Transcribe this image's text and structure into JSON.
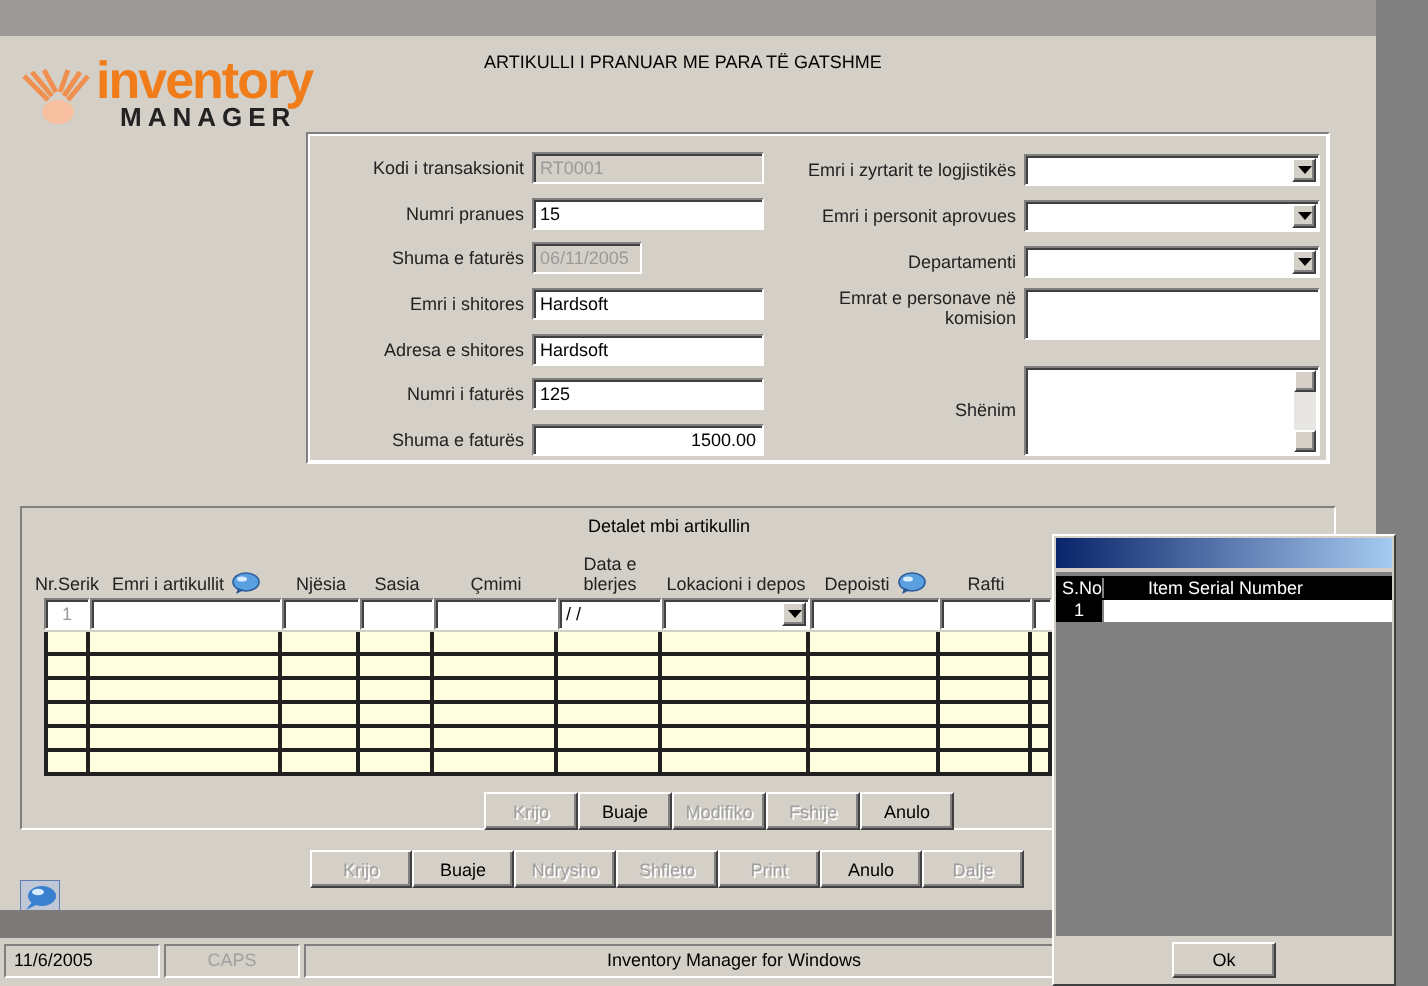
{
  "title": "ARTIKULLI I PRANUAR ME PARA TË GATSHME",
  "logo": {
    "word": "inventory",
    "sub": "MANAGER"
  },
  "left_fields": [
    {
      "label": "Kodi i transaksionit",
      "value": "RT0001",
      "disabled": true,
      "kind": "wide"
    },
    {
      "label": "Numri pranues",
      "value": "15",
      "disabled": false,
      "kind": "wide"
    },
    {
      "label": "Shuma e faturës",
      "value": "06/11/2005",
      "disabled": true,
      "kind": "short"
    },
    {
      "label": "Emri i shitores",
      "value": "Hardsoft",
      "disabled": false,
      "kind": "wide"
    },
    {
      "label": "Adresa e shitores",
      "value": "Hardsoft",
      "disabled": false,
      "kind": "wide"
    },
    {
      "label": "Numri i faturës",
      "value": "125",
      "disabled": false,
      "kind": "wide"
    },
    {
      "label": "Shuma e faturës",
      "value": "1500.00",
      "disabled": false,
      "kind": "amount"
    }
  ],
  "right_fields": [
    {
      "label": "Emri i zyrtarit te logjistikës",
      "kind": "combo"
    },
    {
      "label": "Emri i personit aprovues",
      "kind": "combo"
    },
    {
      "label": "Departamenti",
      "kind": "combo"
    },
    {
      "label": "Emrat e personave në komision",
      "kind": "memo"
    },
    {
      "label": "Shënim",
      "kind": "scroll_memo"
    }
  ],
  "details": {
    "title": "Detalet mbi artikullin",
    "columns": [
      {
        "label": "Nr.Serik",
        "kind": "text",
        "entry": "1"
      },
      {
        "label": "Emri i artikullit",
        "kind": "lookup"
      },
      {
        "label": "Njësia",
        "kind": "text"
      },
      {
        "label": "Sasia",
        "kind": "text"
      },
      {
        "label": "Çmimi",
        "kind": "text"
      },
      {
        "label": "Data e blerjes",
        "kind": "text",
        "entry": "/ /"
      },
      {
        "label": "Lokacioni i depos",
        "kind": "combo"
      },
      {
        "label": "Depoisti",
        "kind": "lookup"
      },
      {
        "label": "Rafti",
        "kind": "text"
      }
    ],
    "buttons": [
      {
        "label": "Krijo",
        "disabled": true
      },
      {
        "label": "Buaje",
        "disabled": false
      },
      {
        "label": "Modifiko",
        "disabled": true
      },
      {
        "label": "Fshije",
        "disabled": true
      },
      {
        "label": "Anulo",
        "disabled": false
      }
    ]
  },
  "actions": [
    {
      "label": "Krijo",
      "disabled": true
    },
    {
      "label": "Buaje",
      "disabled": false
    },
    {
      "label": "Ndrysho",
      "disabled": true
    },
    {
      "label": "Shfleto",
      "disabled": true
    },
    {
      "label": "Print",
      "disabled": true
    },
    {
      "label": "Anulo",
      "disabled": false
    },
    {
      "label": "Dalje",
      "disabled": true
    }
  ],
  "status_bar": {
    "date": "11/6/2005",
    "caps": "CAPS",
    "caps_on": false,
    "app": "Inventory Manager for Windows"
  },
  "popup": {
    "columns": [
      "S.No",
      "Item Serial Number"
    ],
    "rows": [
      {
        "sno": "1"
      }
    ],
    "ok": "Ok"
  }
}
